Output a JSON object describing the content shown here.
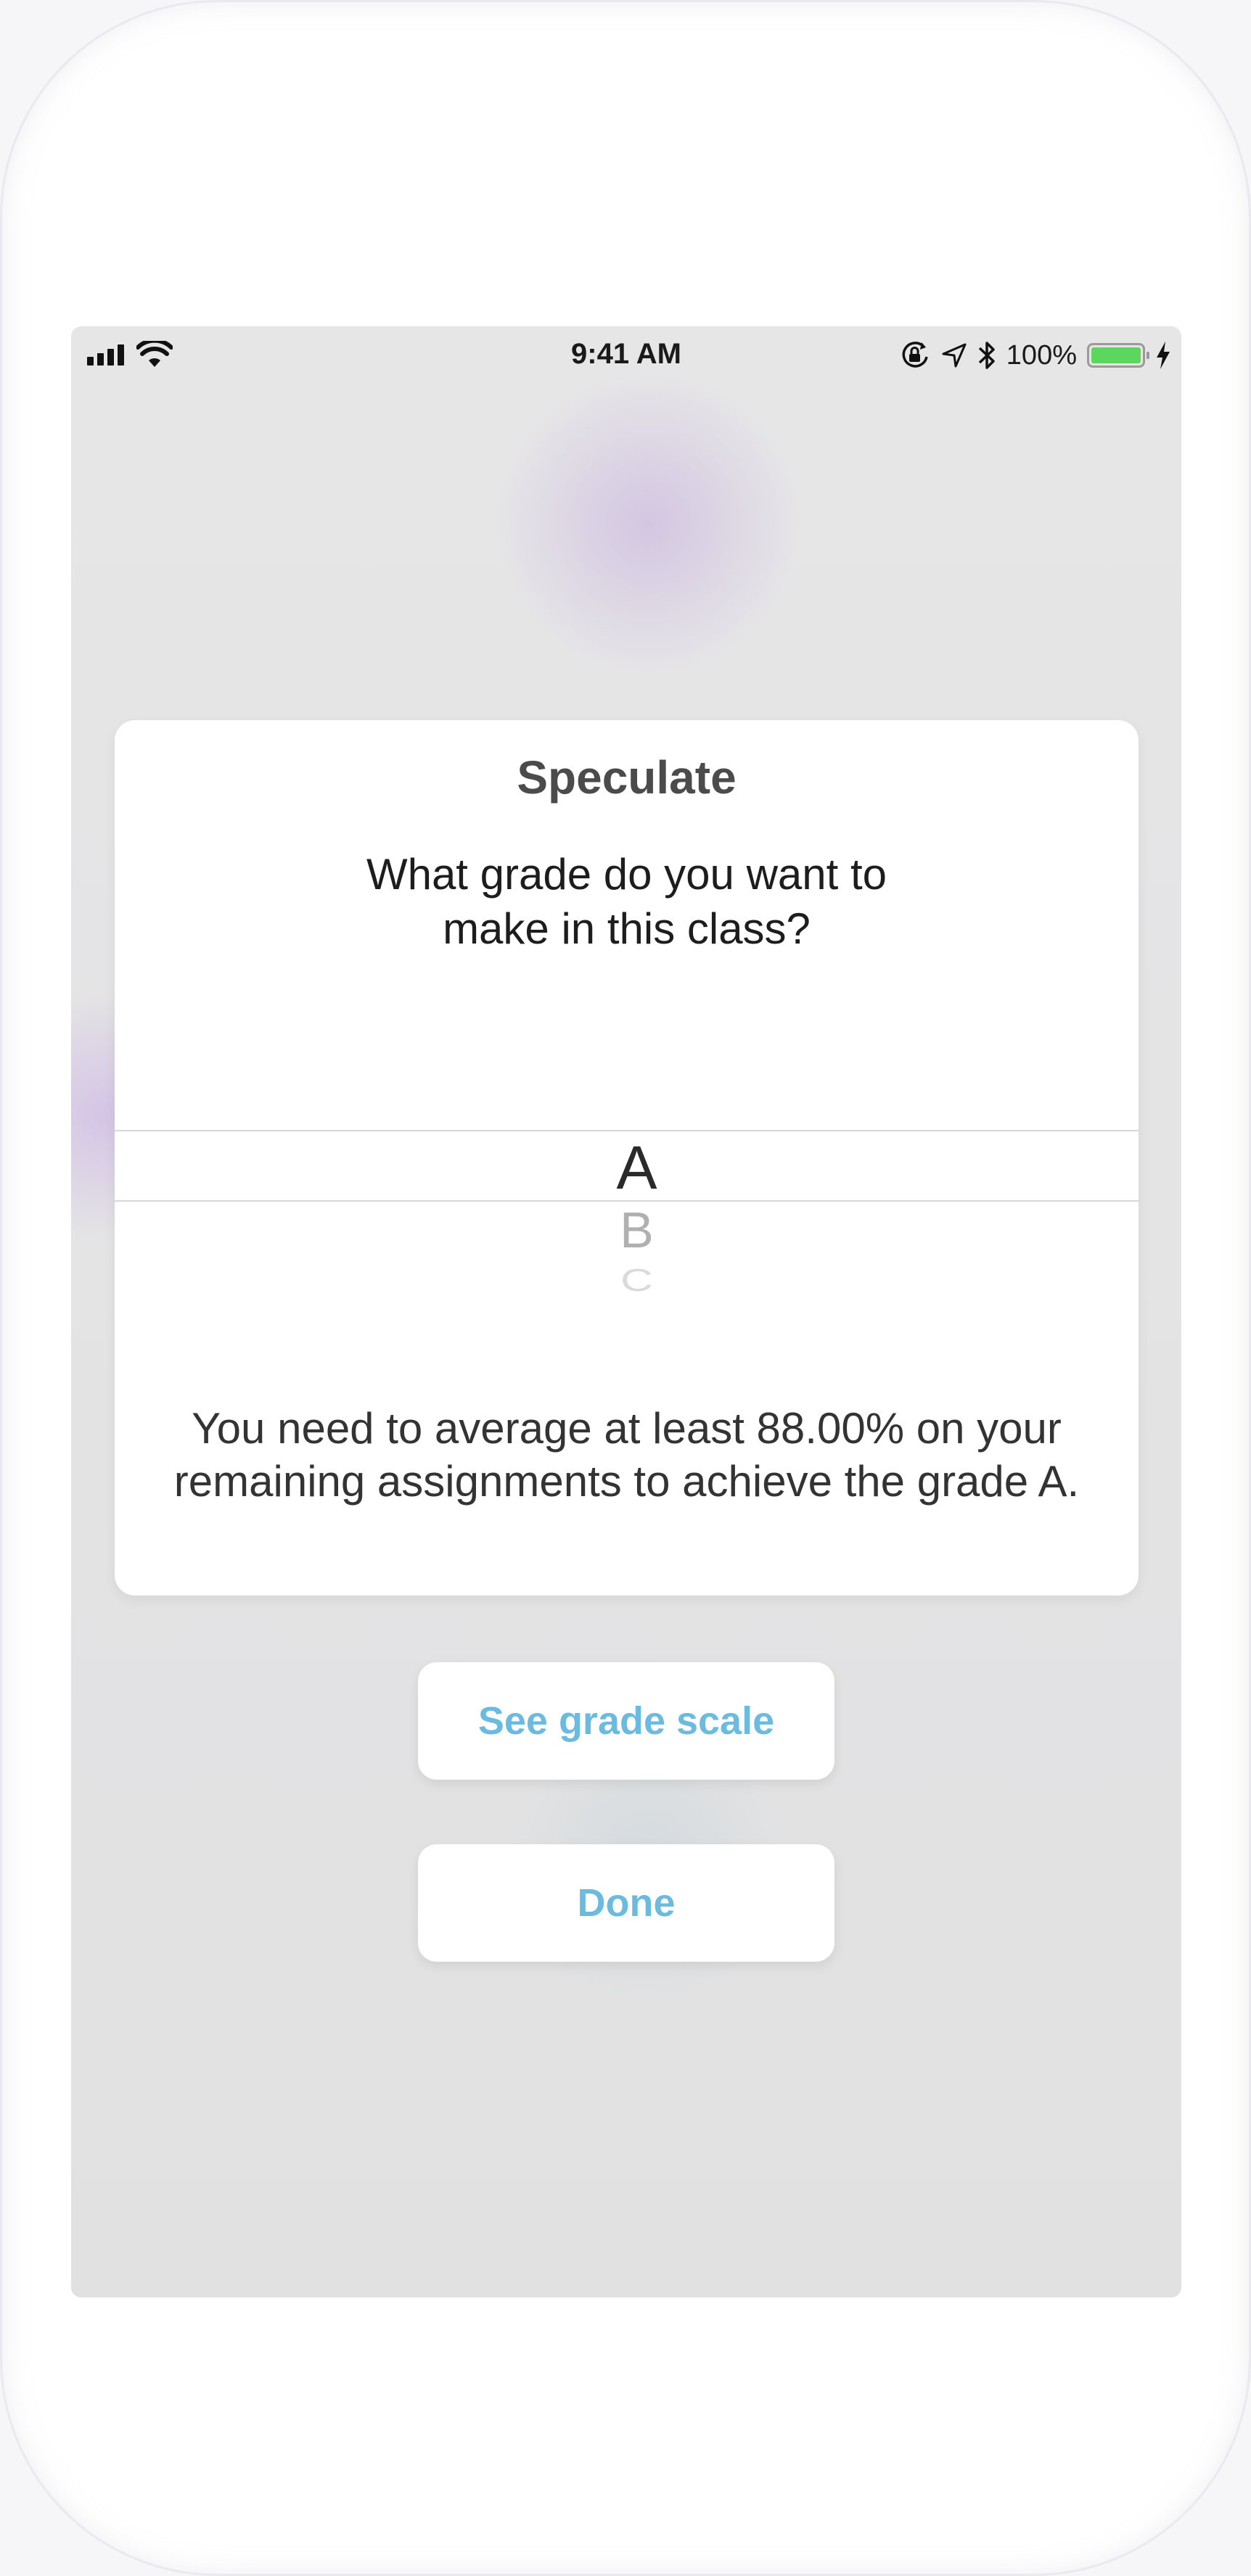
{
  "status_bar": {
    "time": "9:41 AM",
    "battery_percent": "100%",
    "battery_level": 1.0,
    "battery_color": "#5dd65e",
    "icons": [
      "cellular-signal-icon",
      "wifi-icon",
      "orientation-lock-icon",
      "location-arrow-icon",
      "bluetooth-icon",
      "battery-icon",
      "charging-bolt-icon"
    ]
  },
  "dialog": {
    "title": "Speculate",
    "question_line1": "What grade do you want to",
    "question_line2": "make in this class?",
    "picker": {
      "selected": "A",
      "options": [
        "A",
        "B",
        "C"
      ]
    },
    "message_line1": "You need to average at least 88.00% on your",
    "message_line2": "remaining assignments to achieve the grade A."
  },
  "buttons": {
    "grade_scale_label": "See grade scale",
    "done_label": "Done"
  },
  "colors": {
    "accent": "#6bbbe0",
    "title": "#4b4b4b",
    "screen_background": "#e3e3e4"
  }
}
